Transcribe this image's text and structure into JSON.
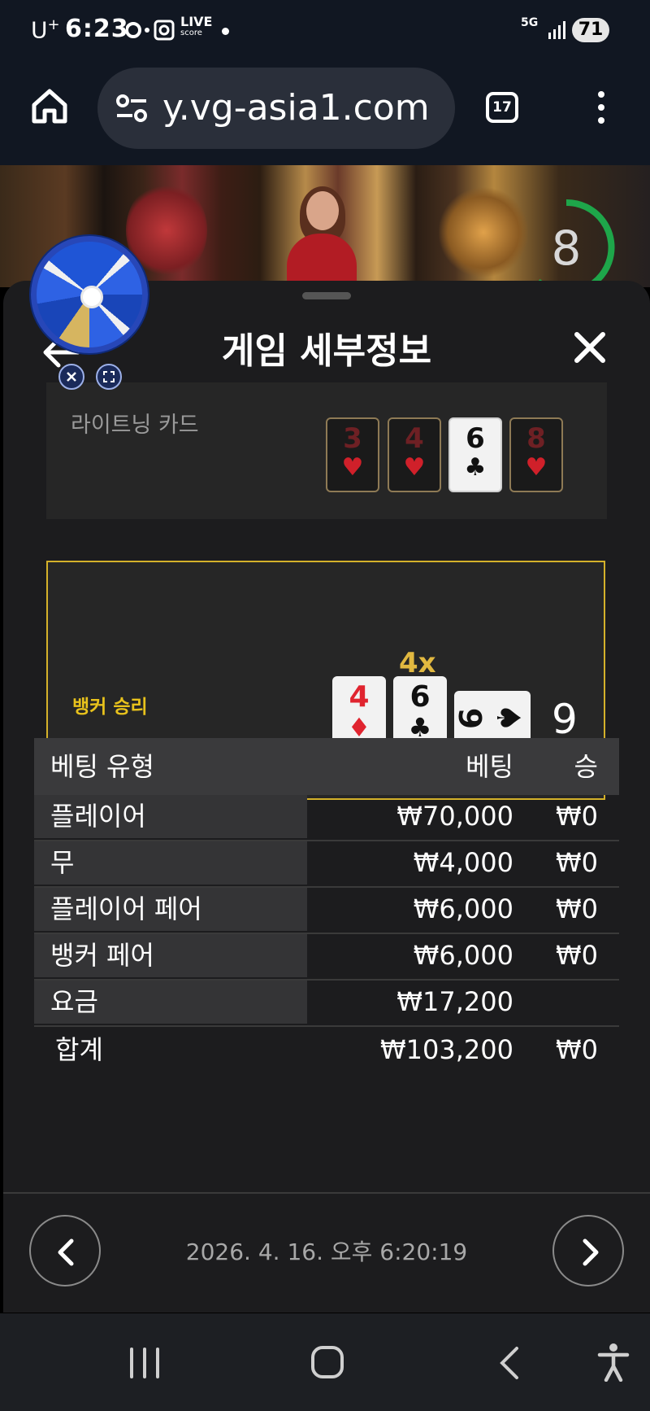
{
  "status_bar": {
    "carrier": "U",
    "carrier_sup": "+",
    "time": "6:23",
    "live_top": "LIVE",
    "live_bottom": "score",
    "network": "5G",
    "battery": "71"
  },
  "browser": {
    "url": "y.vg-asia1.com",
    "tab_count": "17"
  },
  "game": {
    "timer": "8"
  },
  "sheet": {
    "title": "게임 세부정보",
    "lightning": {
      "label": "라이트닝 카드",
      "cards": [
        {
          "rank": "3",
          "suit": "♥",
          "active": false
        },
        {
          "rank": "4",
          "suit": "♥",
          "active": false
        },
        {
          "rank": "6",
          "suit": "♣",
          "active": true
        },
        {
          "rank": "8",
          "suit": "♥",
          "active": false
        }
      ]
    },
    "result": {
      "label": "뱅커 승리",
      "multiplier": "4x",
      "cards": [
        {
          "rank": "4",
          "suit": "♦",
          "color": "#e0242f"
        },
        {
          "rank": "6",
          "suit": "♣",
          "color": "#111111"
        },
        {
          "rank": "9",
          "suit": "♠",
          "color": "#111111",
          "sideways": true
        }
      ],
      "score": "9"
    },
    "bets": {
      "headers": {
        "type": "베팅 유형",
        "bet": "베팅",
        "win": "승"
      },
      "rows": [
        {
          "type": "플레이어",
          "bet": "₩70,000",
          "win": "₩0"
        },
        {
          "type": "무",
          "bet": "₩4,000",
          "win": "₩0"
        },
        {
          "type": "플레이어 페어",
          "bet": "₩6,000",
          "win": "₩0"
        },
        {
          "type": "뱅커 페어",
          "bet": "₩6,000",
          "win": "₩0"
        },
        {
          "type": "요금",
          "bet": "₩17,200",
          "win": ""
        }
      ],
      "total": {
        "type": "합계",
        "bet": "₩103,200",
        "win": "₩0"
      }
    },
    "datetime": "2026. 4. 16. 오후 6:20:19"
  }
}
